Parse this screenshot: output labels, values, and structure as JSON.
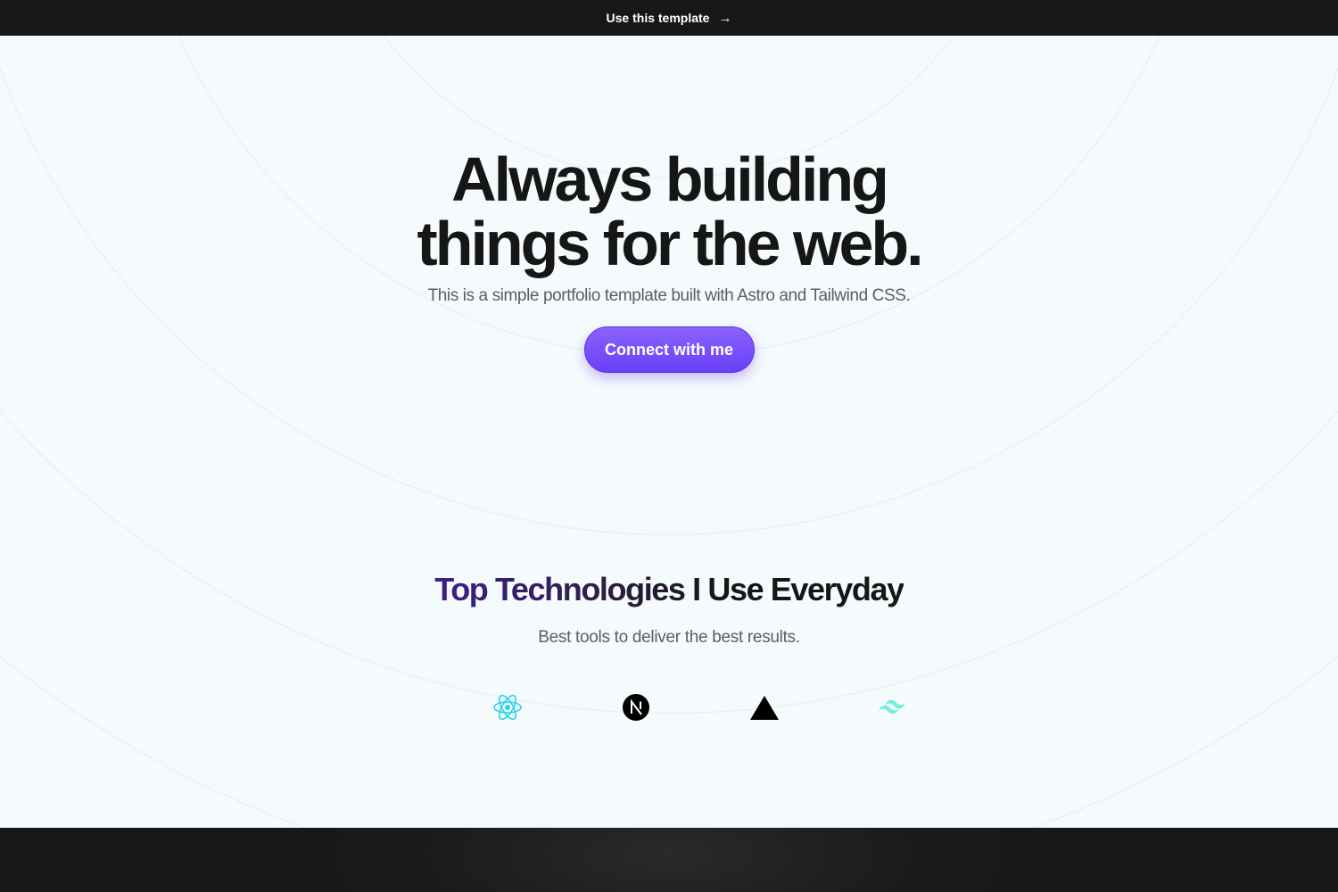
{
  "topbar": {
    "link_label": "Use this template",
    "arrow": "→"
  },
  "hero": {
    "title_line1": "Always building",
    "title_line2": "things for the web.",
    "subtitle": "This is a simple portfolio template built with Astro and Tailwind CSS.",
    "cta_label": "Connect with me"
  },
  "tech": {
    "title": "Top Technologies I Use Everyday",
    "subtitle": "Best tools to deliver the best results.",
    "icons": [
      "react-icon",
      "nextjs-icon",
      "vercel-icon",
      "tailwind-icon"
    ]
  },
  "colors": {
    "accent": "#6b3ff5",
    "background": "#f5fbfd",
    "dark": "#171717"
  }
}
